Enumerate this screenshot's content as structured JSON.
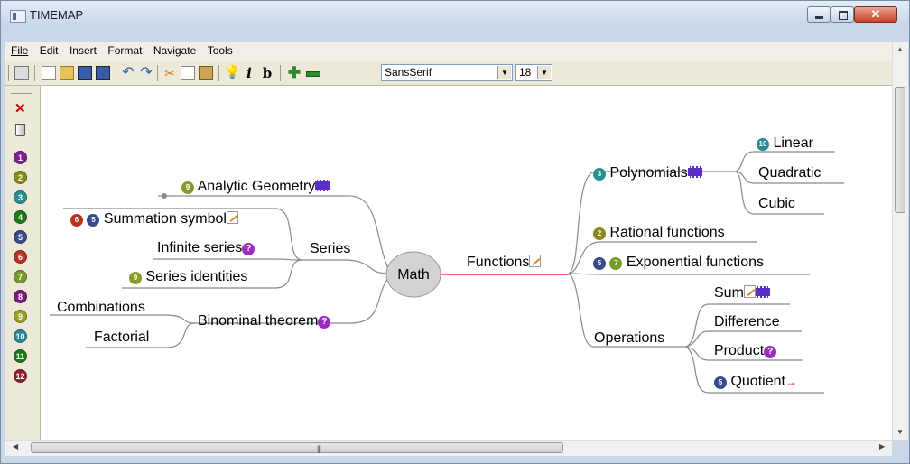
{
  "window": {
    "title": "TIMEMAP"
  },
  "menu": [
    "File",
    "Edit",
    "Insert",
    "Format",
    "Navigate",
    "Tools"
  ],
  "toolbar": {
    "font_name": "SansSerif",
    "font_size": "18",
    "italic_label": "i",
    "bold_label": "b"
  },
  "priorities": [
    "1",
    "2",
    "3",
    "4",
    "5",
    "6",
    "7",
    "8",
    "9",
    "10",
    "11",
    "12"
  ],
  "priority_colors": [
    "#7b1f8c",
    "#8a8a1a",
    "#2a8f8f",
    "#1c7a1c",
    "#3a4a8a",
    "#b83222",
    "#7a9a2a",
    "#7a1a7a",
    "#9aa02a",
    "#2a8a9a",
    "#1a7a1a",
    "#9a1a2a"
  ],
  "mindmap": {
    "root": "Math",
    "left": {
      "analytic_geometry": {
        "label": "Analytic Geometry",
        "badge": "9"
      },
      "series": {
        "label": "Series",
        "summation": {
          "label": "Summation symbol",
          "badges": [
            "6",
            "5"
          ]
        },
        "infinite": {
          "label": "Infinite series"
        },
        "identities": {
          "label": "Series identities",
          "badge": "9"
        }
      },
      "binominal": {
        "label": "Binominal theorem",
        "combinations": "Combinations",
        "factorial": "Factorial"
      }
    },
    "right": {
      "functions": {
        "label": "Functions",
        "polynomials": {
          "label": "Polynomials",
          "badge": "3",
          "linear": {
            "label": "Linear",
            "badge": "10"
          },
          "quadratic": "Quadratic",
          "cubic": "Cubic"
        },
        "rational": {
          "label": "Rational functions",
          "badge": "2"
        },
        "exponential": {
          "label": "Exponential functions",
          "badges": [
            "5",
            "7"
          ]
        },
        "operations": {
          "label": "Operations",
          "sum": "Sum",
          "difference": "Difference",
          "product": "Product",
          "quotient": {
            "label": "Quotient",
            "badge": "5"
          }
        }
      }
    }
  }
}
